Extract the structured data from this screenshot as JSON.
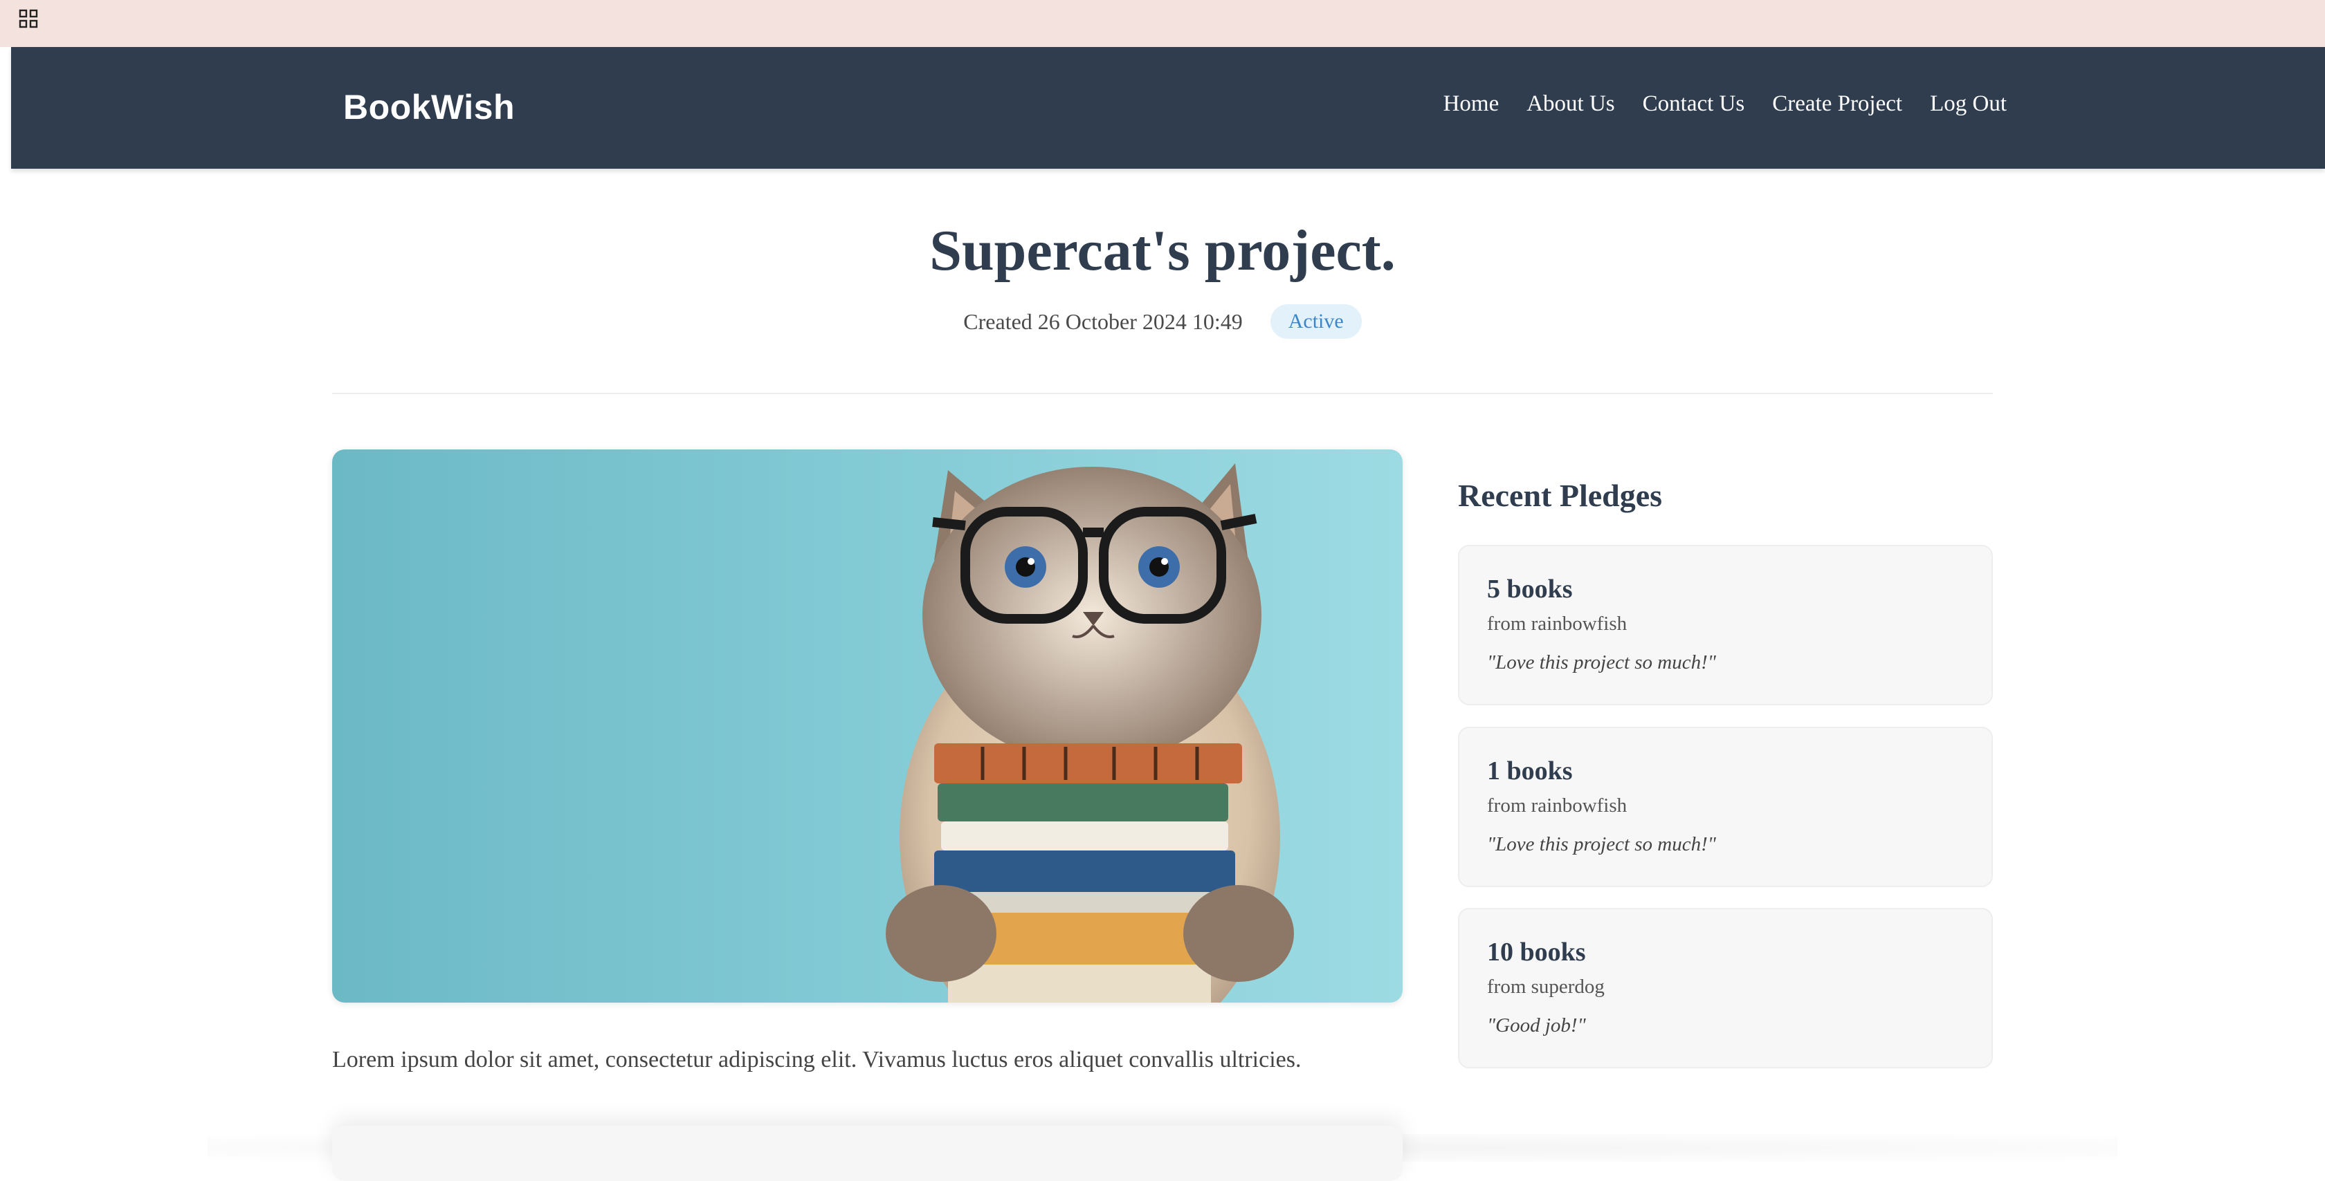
{
  "brand": "BookWish",
  "nav": {
    "home": "Home",
    "about": "About Us",
    "contact": "Contact Us",
    "create": "Create Project",
    "logout": "Log Out"
  },
  "project": {
    "title": "Supercat's project.",
    "created": "Created 26 October 2024 10:49",
    "status": "Active",
    "description": "Lorem ipsum dolor sit amet, consectetur adipiscing elit. Vivamus luctus eros aliquet convallis ultricies."
  },
  "pledges": {
    "heading": "Recent Pledges",
    "items": [
      {
        "amount": "5 books",
        "from": "from rainbowfish",
        "comment": "\"Love this project so much!\""
      },
      {
        "amount": "1 books",
        "from": "from rainbowfish",
        "comment": "\"Love this project so much!\""
      },
      {
        "amount": "10 books",
        "from": "from superdog",
        "comment": "\"Good job!\""
      }
    ]
  },
  "colors": {
    "navbar": "#2f3d4f",
    "topstrip": "#f3e2dd",
    "badge_text": "#3a86c8",
    "badge_bg": "#e3f1fb"
  },
  "icons": {
    "top_left": "grid-icon"
  }
}
